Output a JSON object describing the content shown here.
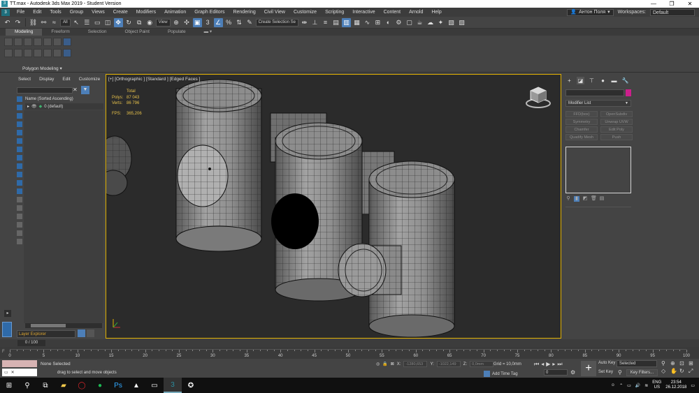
{
  "window": {
    "title": "TT.max - Autodesk 3ds Max 2019 - Student Version",
    "controls": [
      "—",
      "❐",
      "✕"
    ]
  },
  "menu": {
    "items": [
      "File",
      "Edit",
      "Tools",
      "Group",
      "Views",
      "Create",
      "Modifiers",
      "Animation",
      "Graph Editors",
      "Rendering",
      "Civil View",
      "Customize",
      "Scripting",
      "Interactive",
      "Content",
      "Arnold",
      "Help"
    ],
    "user": "Антон Поля",
    "workspaces_label": "Workspaces:",
    "workspace_value": "Default"
  },
  "toolbar": {
    "selection_filter": "All",
    "ref_coord": "View",
    "named_selection": "Create Selection Se"
  },
  "ribbon": {
    "tabs": [
      "Modeling",
      "Freeform",
      "Selection",
      "Object Paint",
      "Populate"
    ],
    "group_label": "Polygon Modeling ▾"
  },
  "scene_explorer": {
    "menu": [
      "Select",
      "Display",
      "Edit",
      "Customize"
    ],
    "header": "Name (Sorted Ascending)",
    "row": "0 (default)",
    "layer_explorer": "Layer Explorer"
  },
  "viewport": {
    "label": "[+] [Orthographic ] [Standard ] [Edged Faces ]",
    "stats": {
      "total": "Total",
      "polys_label": "Polys:",
      "polys_value": "87 043",
      "verts_label": "Verts:",
      "verts_value": "86 796",
      "fps_label": "FPS:",
      "fps_value": "365,206"
    }
  },
  "command_panel": {
    "modifier_list": "Modifier List",
    "buttons": [
      "FFD(box)",
      "OpenSubdiv",
      "Symmetry",
      "Unwrap UVW",
      "Chamfer",
      "Edit Poly",
      "Quadify Mesh",
      "Push"
    ],
    "swatch_color": "#cc1f8c"
  },
  "timeline": {
    "frame_counter": "0 / 100",
    "ticks": [
      0,
      5,
      10,
      15,
      20,
      25,
      30,
      35,
      40,
      45,
      50,
      55,
      60,
      65,
      70,
      75,
      80,
      85,
      90,
      95,
      100
    ]
  },
  "status": {
    "selection": "None Selected",
    "prompt": "drag to select and move objects",
    "x_label": "X:",
    "x_value": "-1280,653",
    "y_label": "Y:",
    "y_value": "-1022,149",
    "z_label": "Z:",
    "z_value": "0,0mm",
    "grid": "Grid = 10,0mm",
    "add_time_tag": "Add Time Tag",
    "frame": "0",
    "auto_key": "Auto Key",
    "set_key": "Set Key",
    "key_selected": "Selected",
    "key_filters": "Key Filters..."
  },
  "taskbar": {
    "lang_top": "ENG",
    "lang_bottom": "US",
    "time": "23:54",
    "date": "26.12.2018"
  }
}
